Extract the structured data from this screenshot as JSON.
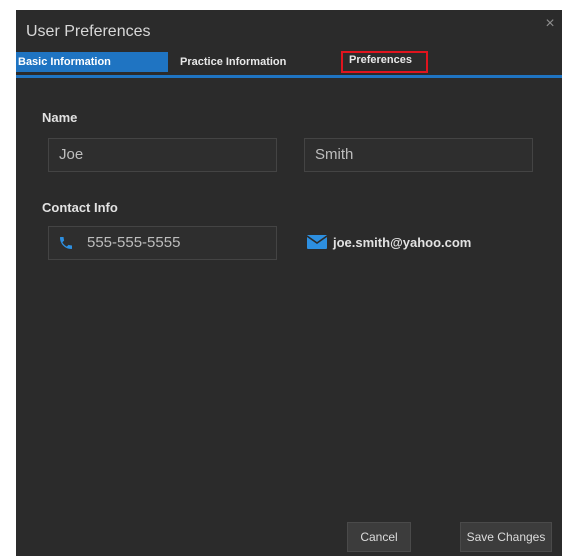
{
  "window": {
    "title": "User Preferences",
    "close_glyph": "×"
  },
  "tabs": [
    {
      "label": "Basic Information",
      "active": true
    },
    {
      "label": "Practice Information",
      "active": false
    },
    {
      "label": "Preferences",
      "active": false,
      "highlighted": true
    }
  ],
  "form": {
    "name_label": "Name",
    "first_name": "Joe",
    "last_name": "Smith",
    "contact_label": "Contact Info",
    "phone": "555-555-5555",
    "email": "joe.smith@yahoo.com"
  },
  "buttons": {
    "cancel": "Cancel",
    "save": "Save Changes"
  },
  "colors": {
    "dialog_bg": "#2b2b2b",
    "accent": "#1f74c2",
    "highlight_border": "#e0141e"
  },
  "icons": {
    "close": "close-icon",
    "phone": "phone-icon",
    "email": "envelope-icon"
  }
}
